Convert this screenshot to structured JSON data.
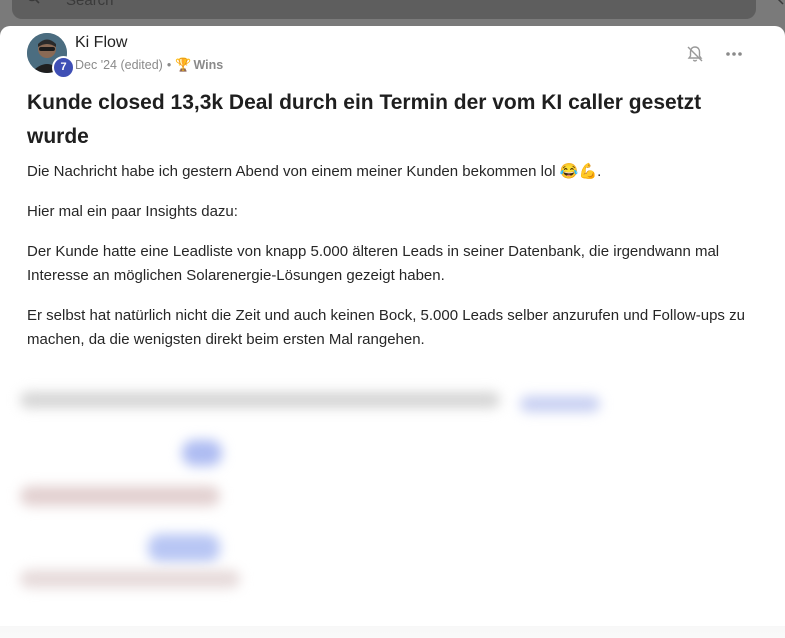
{
  "search": {
    "placeholder": "Search",
    "icon": "search-icon"
  },
  "post": {
    "author": "Ki Flow",
    "level": "7",
    "date": "Dec '24 (edited)",
    "separator": "•",
    "category_icon": "🏆",
    "category": "Wins",
    "title": "Kunde closed 13,3k Deal durch ein Termin der vom KI caller gesetzt wurde",
    "paragraphs": [
      "Die Nachricht habe ich gestern Abend von einem meiner Kunden bekommen lol 😂💪.",
      "Hier mal ein paar Insights dazu:",
      "Der Kunde hatte eine Leadliste von knapp 5.000 älteren Leads in seiner Datenbank, die irgendwann mal Interesse an möglichen Solarenergie-Lösungen gezeigt haben.",
      "Er selbst hat natürlich nicht die Zeit und auch keinen Bock, 5.000 Leads selber anzurufen und Follow-ups zu machen, da die wenigsten direkt beim ersten Mal rangehen."
    ]
  },
  "icons": {
    "bell": "bell-off-icon",
    "more": "more-options-icon"
  },
  "colors": {
    "badge": "#3f4fb5",
    "backdrop": "#7a7a7a"
  }
}
